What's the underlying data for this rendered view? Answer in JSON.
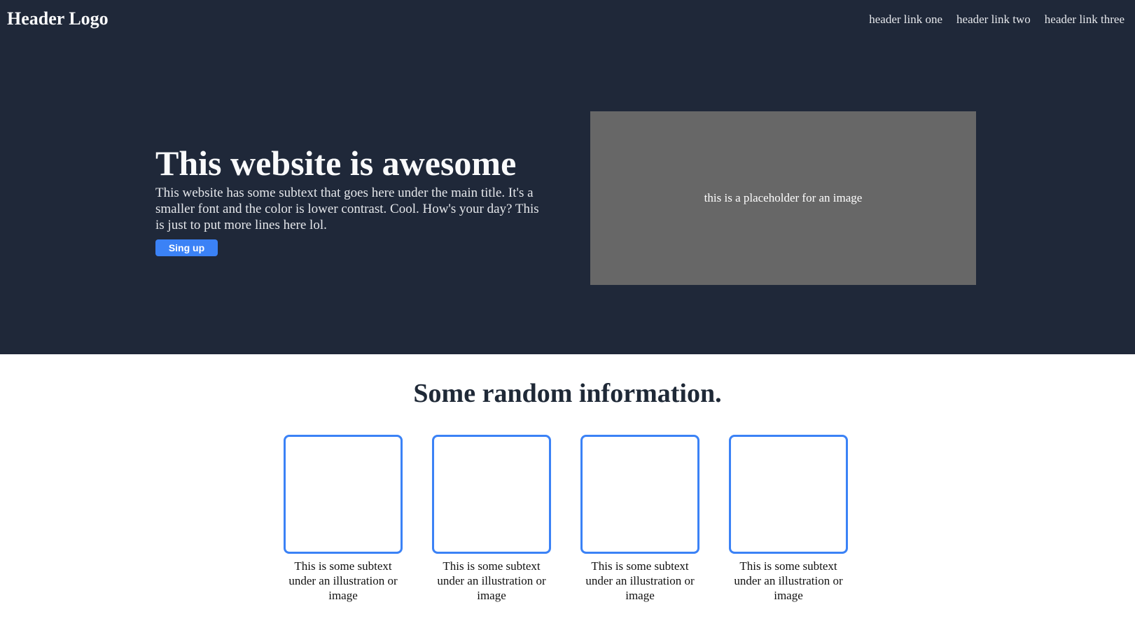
{
  "header": {
    "logo": "Header Logo",
    "links": [
      "header link one",
      "header link two",
      "header link three"
    ]
  },
  "hero": {
    "title": "This website is awesome",
    "subtext": "This website has some subtext that goes here under the main title. It's a smaller font and the color is lower contrast. Cool. How's your day? This is just to put more lines here lol.",
    "button_label": "Sing up",
    "image_placeholder": "this is a placeholder for an image"
  },
  "info": {
    "title": "Some random information.",
    "cards": [
      {
        "text": "This is some subtext under an illustration or image"
      },
      {
        "text": "This is some subtext under an illustration or image"
      },
      {
        "text": "This is some subtext under an illustration or image"
      },
      {
        "text": "This is some subtext under an illustration or image"
      }
    ]
  },
  "colors": {
    "hero_background": "#1f2839",
    "accent": "#3b82f6",
    "placeholder": "#676767"
  }
}
